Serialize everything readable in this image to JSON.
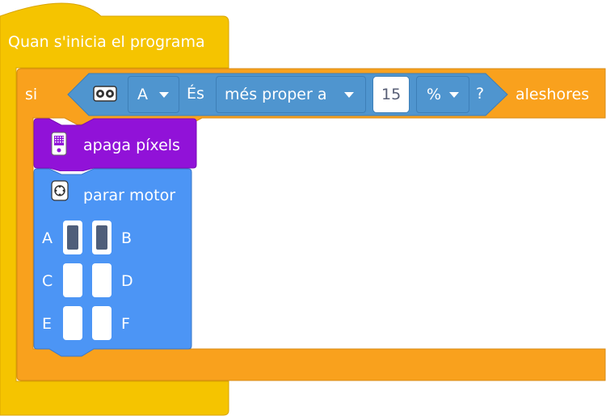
{
  "colors": {
    "events_yellow": "#f5c400",
    "control_orange": "#f9a11d",
    "sensor_blue": "#4f95cf",
    "display_purple": "#9112d8",
    "motor_blue": "#4c95f5"
  },
  "hat": {
    "label": "Quan s'inicia el programa"
  },
  "if_block": {
    "si_label": "si",
    "then_label": "aleshores",
    "condition": {
      "sensor_icon": "distance-sensor-icon",
      "port": "A",
      "es_label": "És",
      "comparison": "més proper a",
      "value": "15",
      "unit": "%",
      "question": "?"
    }
  },
  "display_block": {
    "icon": "light-matrix-icon",
    "label": "apaga píxels"
  },
  "motor_block": {
    "icon": "motor-icon",
    "label": "parar motor",
    "ports": [
      {
        "left": "A",
        "right": "B",
        "left_selected": true,
        "right_selected": true
      },
      {
        "left": "C",
        "right": "D",
        "left_selected": false,
        "right_selected": false
      },
      {
        "left": "E",
        "right": "F",
        "left_selected": false,
        "right_selected": false
      }
    ]
  }
}
